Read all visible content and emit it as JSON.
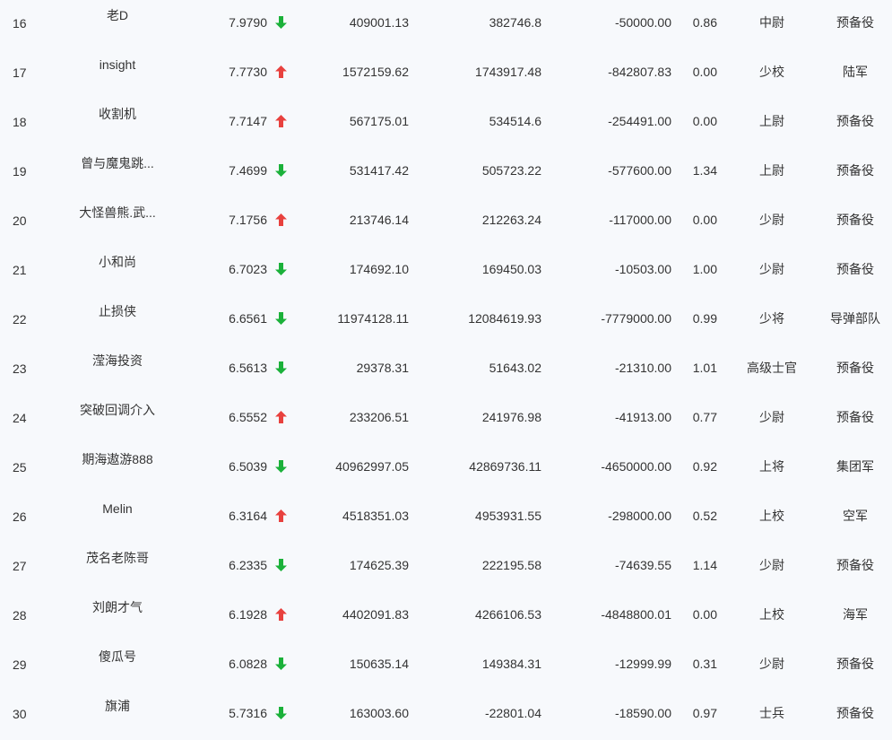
{
  "colors": {
    "up_arrow": "#e8413e",
    "down_arrow": "#1bb13a",
    "text": "#333333",
    "background": "#f7f9fc"
  },
  "rows": [
    {
      "rank": "16",
      "name": "老D",
      "score": "7.9790",
      "trend": "down",
      "value1": "409001.13",
      "value2": "382746.8",
      "value3": "-50000.00",
      "ratio": "0.86",
      "military_rank": "中尉",
      "branch": "预备役"
    },
    {
      "rank": "17",
      "name": "insight",
      "score": "7.7730",
      "trend": "up",
      "value1": "1572159.62",
      "value2": "1743917.48",
      "value3": "-842807.83",
      "ratio": "0.00",
      "military_rank": "少校",
      "branch": "陆军"
    },
    {
      "rank": "18",
      "name": "收割机",
      "score": "7.7147",
      "trend": "up",
      "value1": "567175.01",
      "value2": "534514.6",
      "value3": "-254491.00",
      "ratio": "0.00",
      "military_rank": "上尉",
      "branch": "预备役"
    },
    {
      "rank": "19",
      "name": "曾与魔鬼跳...",
      "score": "7.4699",
      "trend": "down",
      "value1": "531417.42",
      "value2": "505723.22",
      "value3": "-577600.00",
      "ratio": "1.34",
      "military_rank": "上尉",
      "branch": "预备役"
    },
    {
      "rank": "20",
      "name": "大怪兽熊.武...",
      "score": "7.1756",
      "trend": "up",
      "value1": "213746.14",
      "value2": "212263.24",
      "value3": "-117000.00",
      "ratio": "0.00",
      "military_rank": "少尉",
      "branch": "预备役"
    },
    {
      "rank": "21",
      "name": "小和尚",
      "score": "6.7023",
      "trend": "down",
      "value1": "174692.10",
      "value2": "169450.03",
      "value3": "-10503.00",
      "ratio": "1.00",
      "military_rank": "少尉",
      "branch": "预备役"
    },
    {
      "rank": "22",
      "name": "止损侠",
      "score": "6.6561",
      "trend": "down",
      "value1": "11974128.11",
      "value2": "12084619.93",
      "value3": "-7779000.00",
      "ratio": "0.99",
      "military_rank": "少将",
      "branch": "导弹部队"
    },
    {
      "rank": "23",
      "name": "滢海投资",
      "score": "6.5613",
      "trend": "down",
      "value1": "29378.31",
      "value2": "51643.02",
      "value3": "-21310.00",
      "ratio": "1.01",
      "military_rank": "高级士官",
      "branch": "预备役"
    },
    {
      "rank": "24",
      "name": "突破回调介入",
      "score": "6.5552",
      "trend": "up",
      "value1": "233206.51",
      "value2": "241976.98",
      "value3": "-41913.00",
      "ratio": "0.77",
      "military_rank": "少尉",
      "branch": "预备役"
    },
    {
      "rank": "25",
      "name": "期海遨游888",
      "score": "6.5039",
      "trend": "down",
      "value1": "40962997.05",
      "value2": "42869736.11",
      "value3": "-4650000.00",
      "ratio": "0.92",
      "military_rank": "上将",
      "branch": "集团军"
    },
    {
      "rank": "26",
      "name": "Melin",
      "score": "6.3164",
      "trend": "up",
      "value1": "4518351.03",
      "value2": "4953931.55",
      "value3": "-298000.00",
      "ratio": "0.52",
      "military_rank": "上校",
      "branch": "空军"
    },
    {
      "rank": "27",
      "name": "茂名老陈哥",
      "score": "6.2335",
      "trend": "down",
      "value1": "174625.39",
      "value2": "222195.58",
      "value3": "-74639.55",
      "ratio": "1.14",
      "military_rank": "少尉",
      "branch": "预备役"
    },
    {
      "rank": "28",
      "name": "刘朗才气",
      "score": "6.1928",
      "trend": "up",
      "value1": "4402091.83",
      "value2": "4266106.53",
      "value3": "-4848800.01",
      "ratio": "0.00",
      "military_rank": "上校",
      "branch": "海军"
    },
    {
      "rank": "29",
      "name": "傻瓜号",
      "score": "6.0828",
      "trend": "down",
      "value1": "150635.14",
      "value2": "149384.31",
      "value3": "-12999.99",
      "ratio": "0.31",
      "military_rank": "少尉",
      "branch": "预备役"
    },
    {
      "rank": "30",
      "name": "旗浦",
      "score": "5.7316",
      "trend": "down",
      "value1": "163003.60",
      "value2": "-22801.04",
      "value3": "-18590.00",
      "ratio": "0.97",
      "military_rank": "士兵",
      "branch": "预备役"
    }
  ]
}
